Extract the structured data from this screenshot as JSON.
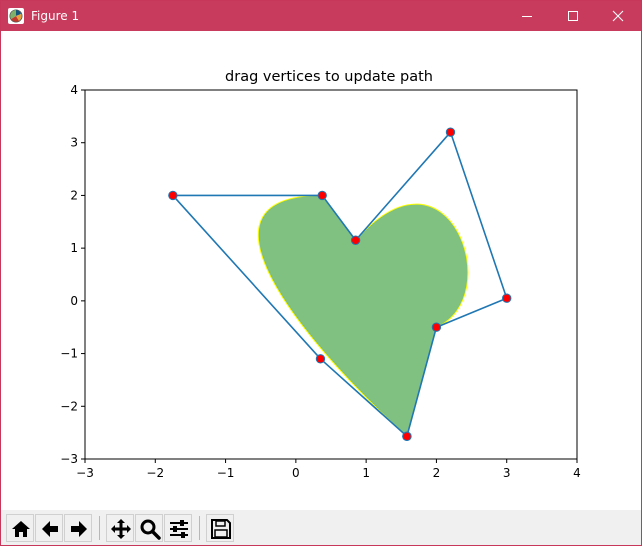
{
  "window": {
    "title": "Figure 1"
  },
  "titlebar_icons": {
    "app": "matplotlib-figure-icon",
    "minimize": "minimize-icon",
    "maximize": "maximize-icon",
    "close": "close-icon"
  },
  "toolbar": {
    "buttons": [
      {
        "name": "home-button",
        "icon": "home-icon"
      },
      {
        "name": "back-button",
        "icon": "arrow-left-icon"
      },
      {
        "name": "forward-button",
        "icon": "arrow-right-icon"
      },
      {
        "name": "pan-button",
        "icon": "move-arrows-icon"
      },
      {
        "name": "zoom-button",
        "icon": "magnifier-icon"
      },
      {
        "name": "configure-subplots-button",
        "icon": "sliders-icon"
      },
      {
        "name": "save-button",
        "icon": "floppy-disk-icon"
      }
    ]
  },
  "chart_data": {
    "type": "line",
    "title": "drag vertices to update path",
    "xlabel": "",
    "ylabel": "",
    "xlim": [
      -3,
      4
    ],
    "ylim": [
      -3,
      4
    ],
    "xticks": [
      "−3",
      "−2",
      "−1",
      "0",
      "1",
      "2",
      "3",
      "4"
    ],
    "yticks": [
      "−3",
      "−2",
      "−1",
      "0",
      "1",
      "2",
      "3",
      "4"
    ],
    "xtick_values": [
      -3,
      -2,
      -1,
      0,
      1,
      2,
      3,
      4
    ],
    "ytick_values": [
      -3,
      -2,
      -1,
      0,
      1,
      2,
      3,
      4
    ],
    "grid": false,
    "vertices": [
      [
        1.58,
        -2.57
      ],
      [
        0.35,
        -1.1
      ],
      [
        -1.75,
        2.0
      ],
      [
        0.375,
        2.0
      ],
      [
        0.85,
        1.15
      ],
      [
        2.2,
        3.2
      ],
      [
        3.0,
        0.05
      ],
      [
        2.0,
        -0.5
      ],
      [
        1.58,
        -2.57
      ]
    ],
    "line_color": "#1f77b4",
    "marker_color": "#ff0000",
    "patch_face_color": "#80c080",
    "patch_edge_color": "#ffff00"
  }
}
